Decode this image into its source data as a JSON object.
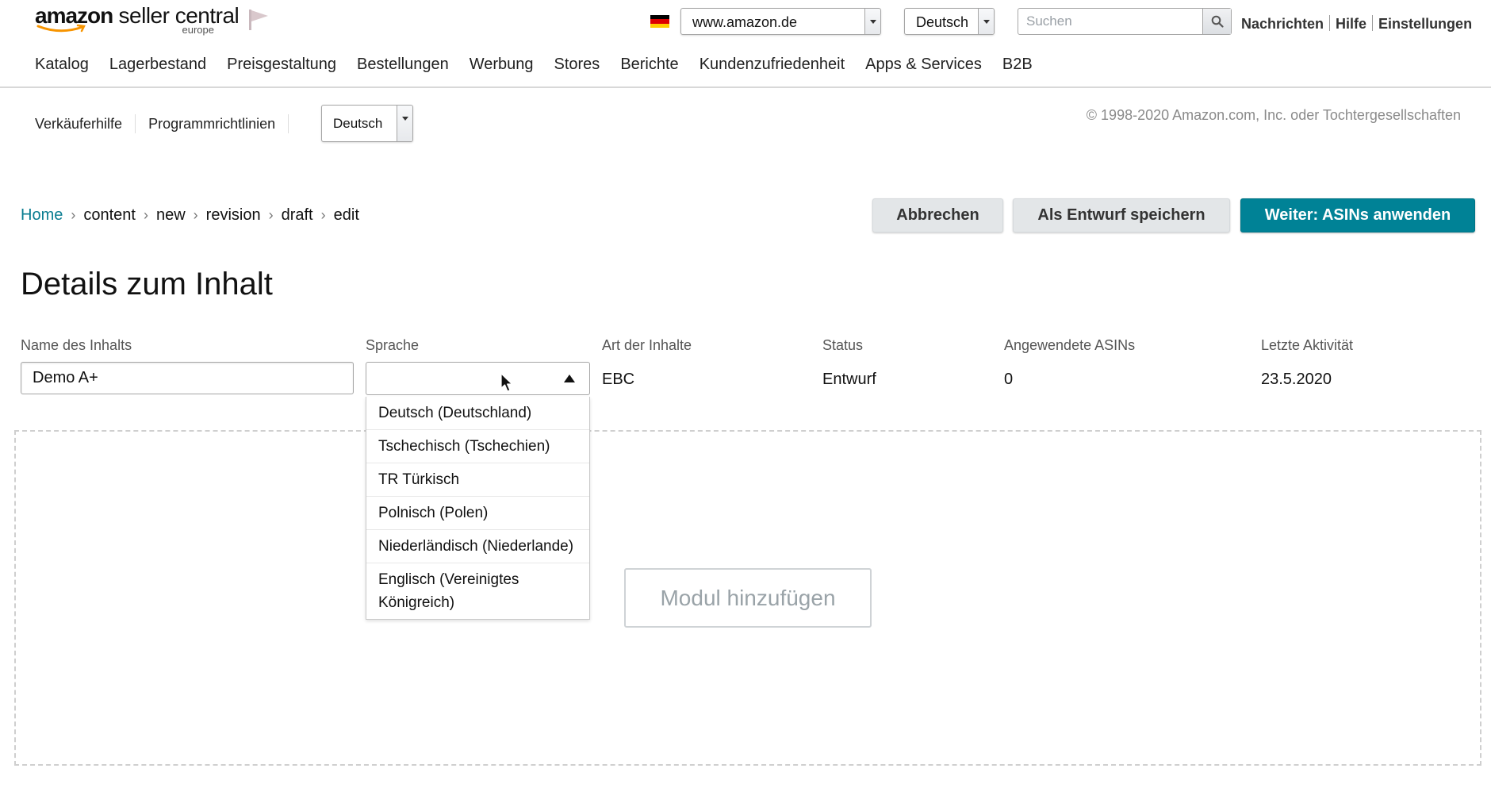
{
  "header": {
    "logo_brand": "amazon",
    "logo_product": " seller central",
    "logo_region": "europe",
    "marketplace": "www.amazon.de",
    "language": "Deutsch",
    "search_placeholder": "Suchen",
    "links": {
      "messages": "Nachrichten",
      "help": "Hilfe",
      "settings": "Einstellungen"
    }
  },
  "nav": {
    "items": [
      "Katalog",
      "Lagerbestand",
      "Preisgestaltung",
      "Bestellungen",
      "Werbung",
      "Stores",
      "Berichte",
      "Kundenzufriedenheit",
      "Apps & Services",
      "B2B"
    ]
  },
  "subnav": {
    "seller_help": "Verkäuferhilfe",
    "program_policies": "Programmrichtlinien",
    "language": "Deutsch",
    "copyright": "© 1998-2020 Amazon.com, Inc. oder Tochtergesellschaften"
  },
  "breadcrumb": {
    "items": [
      "Home",
      "content",
      "new",
      "revision",
      "draft",
      "edit"
    ]
  },
  "actions": {
    "cancel": "Abbrechen",
    "save_draft": "Als Entwurf speichern",
    "next": "Weiter: ASINs anwenden"
  },
  "page_title": "Details zum Inhalt",
  "details": {
    "name_label": "Name des Inhalts",
    "name_value": "Demo A+",
    "language_label": "Sprache",
    "language_value": "",
    "type_label": "Art der Inhalte",
    "type_value": "EBC",
    "status_label": "Status",
    "status_value": "Entwurf",
    "asins_label": "Angewendete ASINs",
    "asins_value": "0",
    "last_activity_label": "Letzte Aktivität",
    "last_activity_value": "23.5.2020"
  },
  "language_options": [
    "Deutsch (Deutschland)",
    "Tschechisch (Tschechien)",
    "TR Türkisch",
    "Polnisch (Polen)",
    "Niederländisch (Niederlande)",
    "Englisch (Vereinigtes Königreich)"
  ],
  "module": {
    "add_label": "Modul hinzufügen"
  },
  "colors": {
    "accent": "#008296",
    "link": "#0a7d91",
    "smile": "#f79400"
  },
  "icons": [
    "amazon-smile-icon",
    "flag-icon",
    "germany-flag-icon",
    "search-icon",
    "chevron-down-icon",
    "chevron-right-icon",
    "arrow-up-icon",
    "mouse-cursor-icon"
  ]
}
